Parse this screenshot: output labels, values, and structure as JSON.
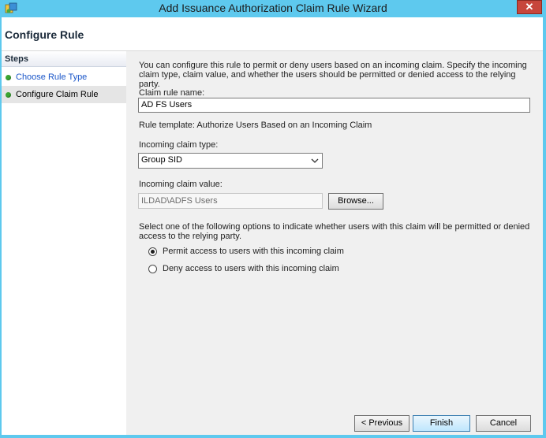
{
  "window": {
    "title": "Add Issuance Authorization Claim Rule Wizard",
    "close_label": "✕"
  },
  "header": {
    "title": "Configure Rule"
  },
  "steps": {
    "heading": "Steps",
    "items": [
      {
        "label": "Choose Rule Type",
        "state": "completed-link"
      },
      {
        "label": "Configure Claim Rule",
        "state": "current"
      }
    ]
  },
  "form": {
    "description": "You can configure this rule to permit or deny users based on an incoming claim. Specify the incoming claim type, claim value, and whether the users should be permitted or denied access to the relying party.",
    "claim_rule_name_label": "Claim rule name:",
    "claim_rule_name_value": "AD FS Users",
    "rule_template_text": "Rule template: Authorize Users Based on an Incoming Claim",
    "incoming_claim_type_label": "Incoming claim type:",
    "incoming_claim_type_value": "Group SID",
    "incoming_claim_value_label": "Incoming claim value:",
    "incoming_claim_value_value": "ILDAD\\ADFS Users",
    "browse_label": "Browse...",
    "options_instruction": "Select one of the following options to indicate whether users with this claim will be permitted or denied access to the relying party.",
    "options": [
      {
        "label": "Permit access to users with this incoming claim",
        "checked": true
      },
      {
        "label": "Deny access to users with this incoming claim",
        "checked": false
      }
    ]
  },
  "buttons": {
    "previous": "< Previous",
    "finish": "Finish",
    "cancel": "Cancel"
  },
  "colors": {
    "title_bar": "#5ec9ee",
    "close_button": "#c7463c",
    "step_link": "#1a56c9",
    "step_dot": "#3aa531"
  }
}
